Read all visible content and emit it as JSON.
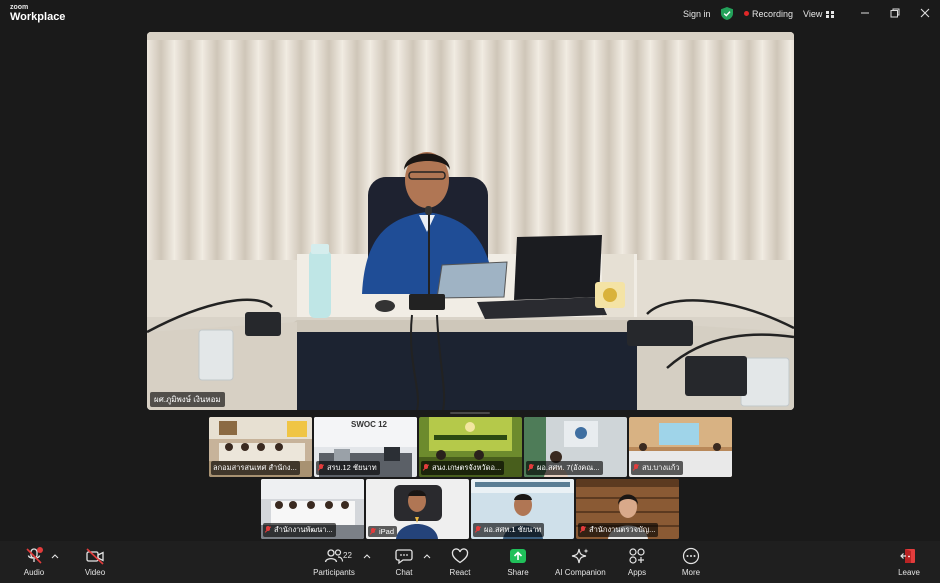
{
  "app": {
    "brand_small": "zoom",
    "brand_big": "Workplace",
    "sign_in": "Sign in",
    "recording": "Recording",
    "view": "View"
  },
  "colors": {
    "background": "#1a1a1a",
    "recording_dot": "#e02828",
    "shield": "#23a15a",
    "share": "#20c05a",
    "muted": "#e23c3c"
  },
  "speaker": {
    "name": "ผศ.ภูมิพงษ์ เงินหอม"
  },
  "participants": [
    {
      "name": "ลกอมสารสนเทศ สำนักง..."
    },
    {
      "name": "สรบ.12 ชัยนาท"
    },
    {
      "name": "สนง.เกษตรจังหวัดอ..."
    },
    {
      "name": "ผอ.สศท. 7(อังคณ..."
    },
    {
      "name": "สบ.บางแก้ว"
    },
    {
      "name": "สำนักงานพัฒนา..."
    },
    {
      "name": "iPad"
    },
    {
      "name": "ผอ.สศท.1 ชัยนาท"
    },
    {
      "name": "สำนักงานตรวจบัญ..."
    }
  ],
  "thumb_texts": {
    "swoc": "SWOC 12"
  },
  "toolbar": {
    "audio": "Audio",
    "video": "Video",
    "participants": "Participants",
    "participants_count": "22",
    "chat": "Chat",
    "react": "React",
    "share": "Share",
    "ai_companion": "AI Companion",
    "apps": "Apps",
    "more": "More",
    "leave": "Leave"
  }
}
